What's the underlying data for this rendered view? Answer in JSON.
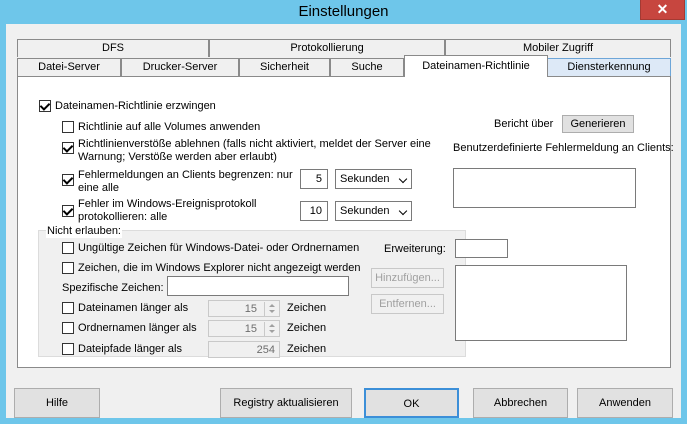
{
  "window": {
    "title": "Einstellungen",
    "close": "✕"
  },
  "tabs_row1": [
    {
      "label": "DFS"
    },
    {
      "label": "Protokollierung"
    },
    {
      "label": "Mobiler Zugriff"
    }
  ],
  "tabs_row2": [
    {
      "label": "Datei-Server"
    },
    {
      "label": "Drucker-Server"
    },
    {
      "label": "Sicherheit"
    },
    {
      "label": "Suche"
    },
    {
      "label": "Dateinamen-Richtlinie"
    },
    {
      "label": "Diensterkennung"
    }
  ],
  "policy": {
    "enforce_label": "Dateinamen-Richtlinie erzwingen",
    "enforce_checked": true,
    "all_volumes_label": "Richtlinie auf alle Volumes anwenden",
    "all_volumes_checked": false,
    "reject_line1": "Richtlinienverstöße ablehnen (falls nicht aktiviert, meldet der Server eine",
    "reject_line2": "Warnung; Verstöße werden aber erlaubt)",
    "reject_checked": true,
    "limit_line1": "Fehlermeldungen an Clients begrenzen: nur",
    "limit_line2": "eine alle",
    "limit_checked": true,
    "limit_value": "5",
    "limit_unit": "Sekunden",
    "log_line1": "Fehler im Windows-Ereignisprotokoll",
    "log_line2": "protokollieren: alle",
    "log_checked": true,
    "log_value": "10",
    "log_unit": "Sekunden"
  },
  "report": {
    "label": "Bericht über",
    "button": "Generieren",
    "custom_msg_label": "Benutzerdefinierte Fehlermeldung an Clients:",
    "custom_msg_value": ""
  },
  "disallow": {
    "legend": "Nicht erlauben:",
    "invalid_chars_label": "Ungültige Zeichen für Windows-Datei- oder Ordnernamen",
    "invalid_chars_checked": false,
    "hidden_chars_label": "Zeichen, die im Windows Explorer nicht angezeigt werden",
    "hidden_chars_checked": false,
    "special_chars_label": "Spezifische Zeichen:",
    "special_chars_value": "",
    "filename_label": "Dateinamen länger als",
    "filename_value": "15",
    "filename_unit": "Zeichen",
    "foldername_label": "Ordnernamen länger als",
    "foldername_value": "15",
    "foldername_unit": "Zeichen",
    "path_label": "Dateipfade länger als",
    "path_value": "254",
    "path_unit": "Zeichen",
    "extension_label": "Erweiterung:",
    "extension_value": "",
    "add_button": "Hinzufügen...",
    "remove_button": "Entfernen..."
  },
  "footer": {
    "help": "Hilfe",
    "registry": "Registry aktualisieren",
    "ok": "OK",
    "cancel": "Abbrechen",
    "apply": "Anwenden"
  }
}
